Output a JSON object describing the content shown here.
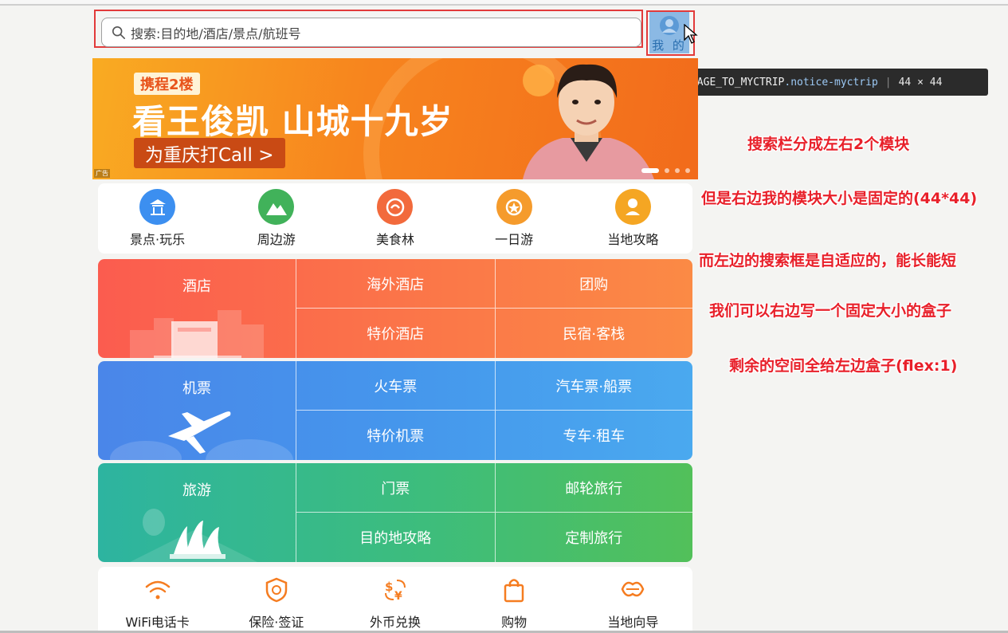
{
  "header": {
    "search_placeholder": "搜索:目的地/酒店/景点/航班号",
    "mine_label": "我 的"
  },
  "tooltip": {
    "tag": "a",
    "id": "#HOMEPAGE_TO_MYCTRIP",
    "class": ".notice-myctrip",
    "size": "44 × 44"
  },
  "banner": {
    "tag": "携程2楼",
    "title": "看王俊凯 山城十九岁",
    "cta": "为重庆打Call >",
    "ad": "广告",
    "slides": 4,
    "active_slide": 1
  },
  "quick_nav": [
    {
      "label": "景点·玩乐",
      "icon": "temple-icon",
      "color": "#3c8ff0"
    },
    {
      "label": "周边游",
      "icon": "mountain-icon",
      "color": "#41b25a"
    },
    {
      "label": "美食林",
      "icon": "food-icon",
      "color": "#f26a3c"
    },
    {
      "label": "一日游",
      "icon": "sun-icon",
      "color": "#f59b2c"
    },
    {
      "label": "当地攻略",
      "icon": "location-pin-icon",
      "color": "#f5a623"
    }
  ],
  "grid": {
    "hotel": {
      "main": "酒店",
      "cells": [
        "海外酒店",
        "团购",
        "特价酒店",
        "民宿·客栈"
      ]
    },
    "flight": {
      "main": "机票",
      "cells": [
        "火车票",
        "汽车票·船票",
        "特价机票",
        "专车·租车"
      ]
    },
    "travel": {
      "main": "旅游",
      "cells": [
        "门票",
        "邮轮旅行",
        "目的地攻略",
        "定制旅行"
      ]
    }
  },
  "services": [
    {
      "label": "WiFi电话卡",
      "icon": "wifi-icon"
    },
    {
      "label": "保险·签证",
      "icon": "shield-icon"
    },
    {
      "label": "外币兑换",
      "icon": "currency-exchange-icon"
    },
    {
      "label": "购物",
      "icon": "shopping-bag-icon"
    },
    {
      "label": "当地向导",
      "icon": "guide-icon"
    }
  ],
  "notes": [
    "搜索栏分成左右2个模块",
    "但是右边我的模块大小是固定的(44*44)",
    "而左边的搜索框是自适应的，能长能短",
    "我们可以右边写一个固定大小的盒子",
    "剩余的空间全给左边盒子(flex:1)"
  ],
  "colors": {
    "annotation": "#e8202a",
    "frame": "#e23a3a",
    "accent": "#ff7a1a"
  }
}
